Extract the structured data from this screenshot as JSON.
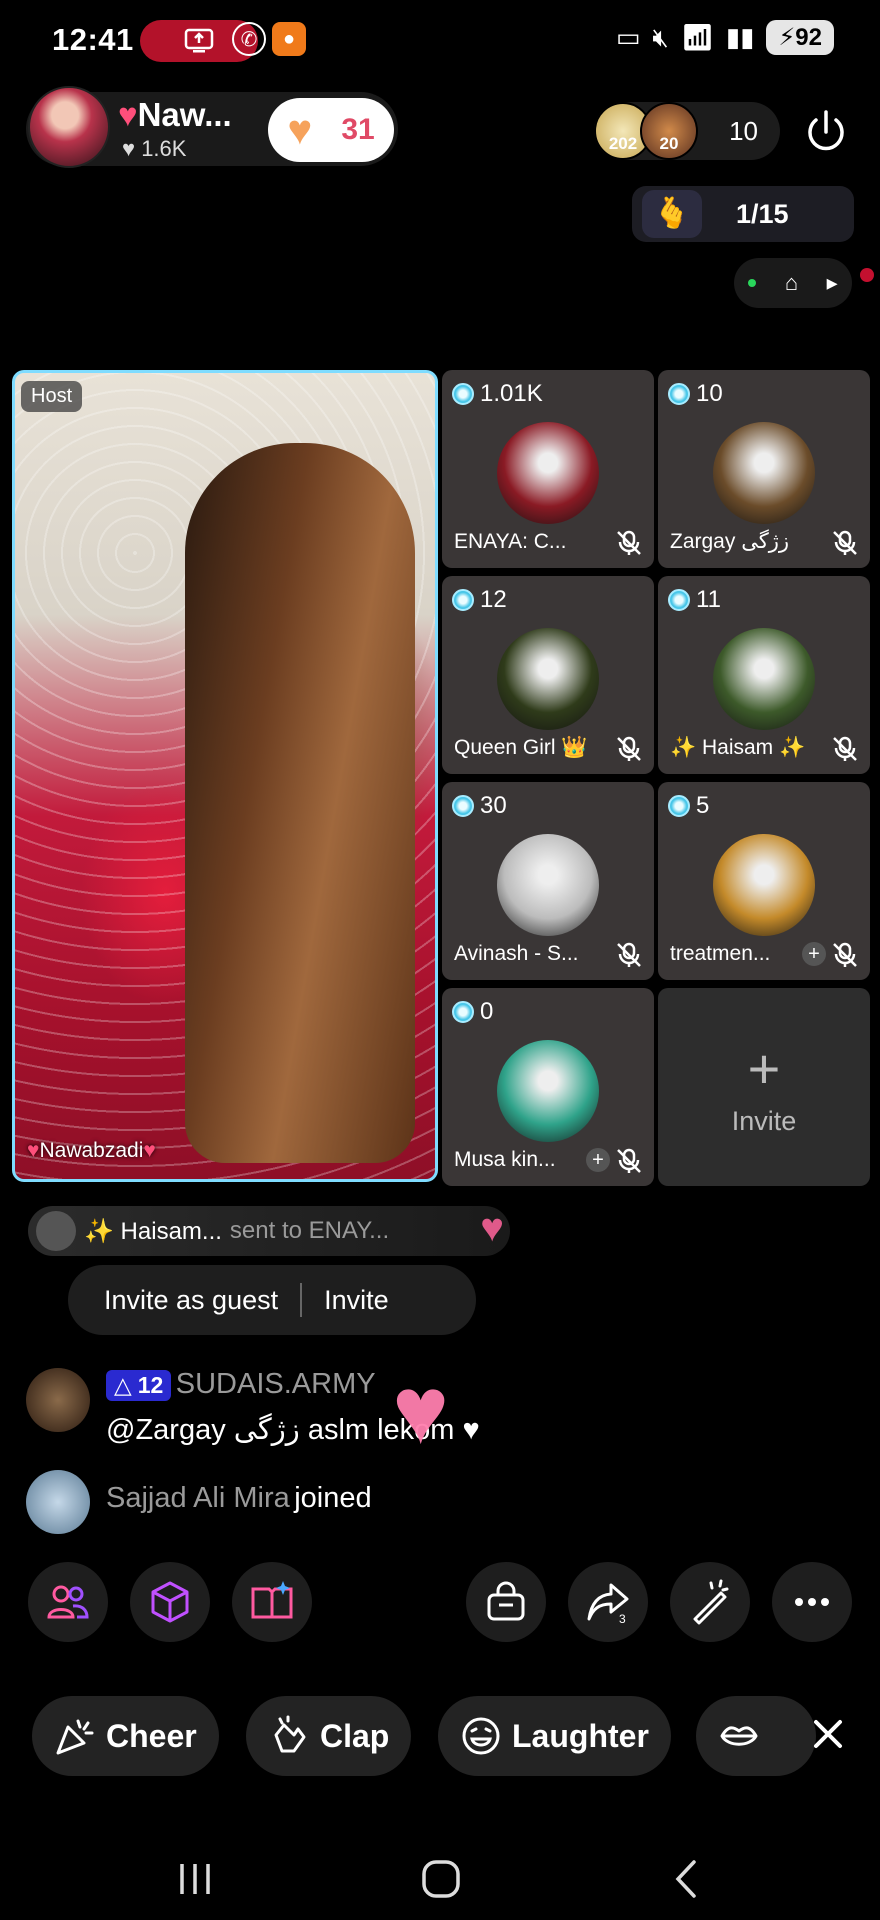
{
  "status_bar": {
    "time": "12:41",
    "battery": "92",
    "signal": "5"
  },
  "host": {
    "name": "Naw...",
    "likes": "1.6K",
    "follow_count": "31"
  },
  "viewers": {
    "badge_1": "202",
    "badge_2": "20",
    "count": "10"
  },
  "seats_indicator": "1/15",
  "host_video": {
    "tag": "Host",
    "name": "Nawabzadi"
  },
  "guests": [
    {
      "score": "1.01K",
      "name": "ENAYA: C...",
      "avatar_color": "#8a1a24"
    },
    {
      "score": "10",
      "name": "Zargay زژگی",
      "avatar_color": "#6b4c2a"
    },
    {
      "score": "12",
      "name": "Queen Girl 👑",
      "avatar_color": "#2f3b1a"
    },
    {
      "score": "11",
      "name": "✨ Haisam ✨",
      "avatar_color": "#3d5a2a"
    },
    {
      "score": "30",
      "name": "Avinash - S...",
      "avatar_color": "#bcbcbc"
    },
    {
      "score": "5",
      "name": "treatmen...",
      "avatar_color": "#c48a2a"
    },
    {
      "score": "0",
      "name": "Musa kin...",
      "avatar_color": "#2fa38a"
    }
  ],
  "invite_seat_label": "Invite",
  "gift_line": {
    "sender": "✨ Haisam...",
    "text": "sent to ENAY..."
  },
  "invite_popup": {
    "invite_as_guest": "Invite as guest",
    "invite": "Invite"
  },
  "chat": [
    {
      "level": "12",
      "user": "SUDAIS.ARMY",
      "message": "@Zargay زژگی aslm  lekom ♥"
    },
    {
      "user": "Sajjad Ali Mira",
      "message": "joined"
    }
  ],
  "reactions": [
    {
      "label": "Cheer"
    },
    {
      "label": "Clap"
    },
    {
      "label": "Laughter"
    }
  ],
  "colors": {
    "accent_pink": "#e04a66",
    "badge_blue": "#2a2ad0",
    "host_border": "#7fdcff",
    "recording_red": "#b3122a"
  }
}
